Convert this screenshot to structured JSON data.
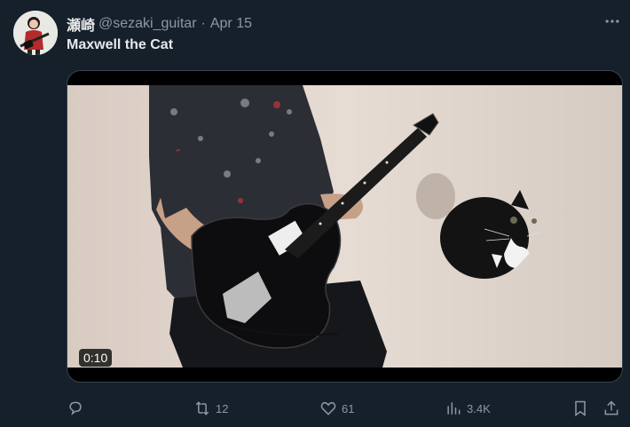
{
  "author": {
    "display_name": "瀬崎",
    "handle": "@sezaki_guitar",
    "separator": "·",
    "date": "Apr 15"
  },
  "tweet": {
    "text": "Maxwell the Cat"
  },
  "media": {
    "duration": "0:10"
  },
  "actions": {
    "reply_count": "",
    "retweet_count": "12",
    "like_count": "61",
    "views_count": "3.4K"
  },
  "icons": {
    "reply": "reply-icon",
    "retweet": "retweet-icon",
    "like": "heart-icon",
    "views": "views-icon",
    "bookmark": "bookmark-icon",
    "share": "share-icon",
    "more": "more-icon"
  },
  "colors": {
    "background": "#15202b",
    "primary_text": "#e7e9ea",
    "secondary_text": "#8b98a5",
    "border": "#38444d"
  }
}
